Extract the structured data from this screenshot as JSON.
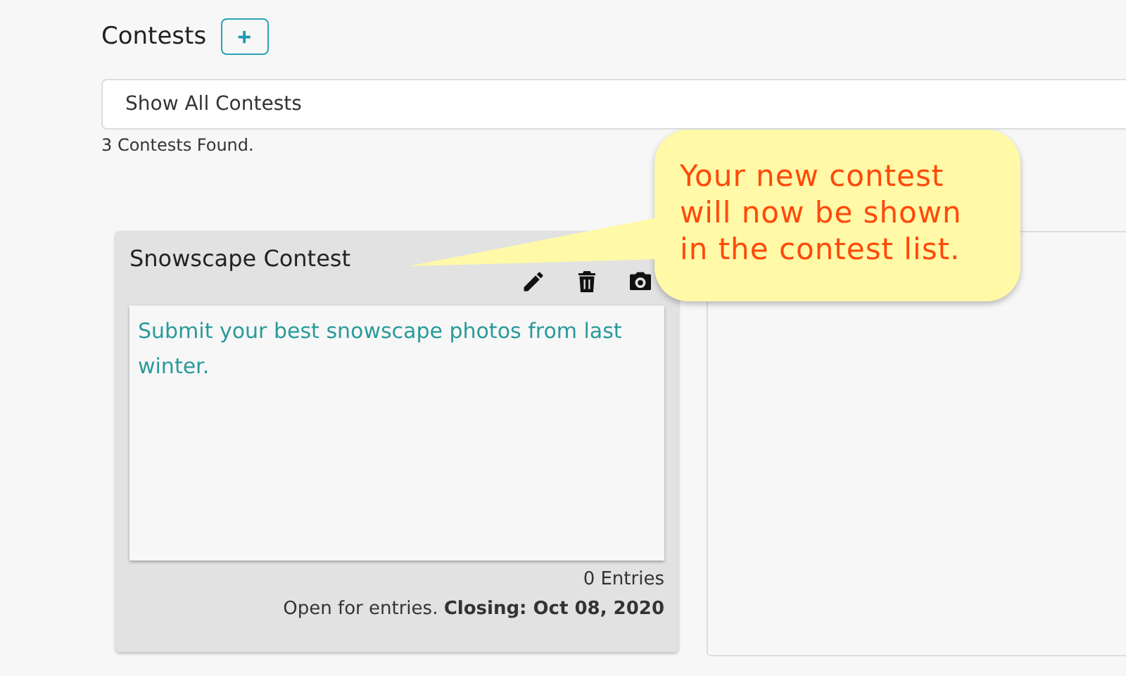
{
  "header": {
    "title": "Contests",
    "add_button": "+"
  },
  "filter": {
    "value": "Show All Contests"
  },
  "result_count": "3 Contests Found.",
  "contests": [
    {
      "title": "Snowscape Contest",
      "description": "Submit your best snowscape photos from last winter.",
      "entries": "0 Entries",
      "status": "Open for entries. **Closing: Oct 08, 2020**"
    }
  ],
  "callout": {
    "lines": [
      "Your new contest",
      "will now be shown",
      "in the contest list."
    ]
  }
}
